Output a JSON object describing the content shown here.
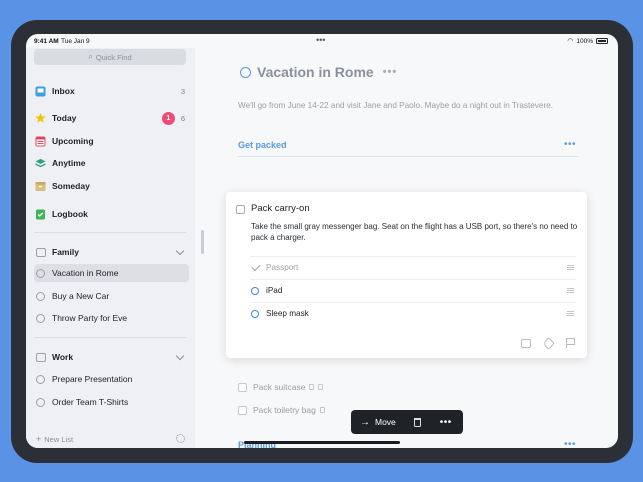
{
  "status": {
    "time": "9:41 AM",
    "date": "Tue Jan 9",
    "battery": "100%"
  },
  "sidebar": {
    "quick_find": "Quick Find",
    "items": [
      {
        "label": "Inbox",
        "count": "3"
      },
      {
        "label": "Today",
        "badge": "1",
        "count": "6"
      },
      {
        "label": "Upcoming"
      },
      {
        "label": "Anytime"
      },
      {
        "label": "Someday"
      },
      {
        "label": "Logbook"
      }
    ],
    "areas": [
      {
        "label": "Family",
        "projects": [
          "Vacation in Rome",
          "Buy a New Car",
          "Throw Party for Eve"
        ]
      },
      {
        "label": "Work",
        "projects": [
          "Prepare Presentation",
          "Order Team T-Shirts"
        ]
      }
    ],
    "new_list": "New List"
  },
  "project": {
    "title": "Vacation in Rome",
    "notes": "We'll go from June 14-22 and visit Jane and Paolo. Maybe do a night out in Trastevere."
  },
  "headings": [
    "Get packed",
    "Planning"
  ],
  "open_todo": {
    "title": "Pack carry-on",
    "notes": "Take the small gray messenger bag. Seat on the flight has a USB port, so there's no need to pack a charger.",
    "checklist": [
      {
        "label": "Passport",
        "done": true
      },
      {
        "label": "iPad",
        "done": false
      },
      {
        "label": "Sleep mask",
        "done": false
      }
    ]
  },
  "todos": [
    "Pack suitcase",
    "Pack toiletry bag"
  ],
  "toolbar": {
    "move": "Move"
  },
  "colors": {
    "accent": "#5a9ae0",
    "badge": "#ee4b76",
    "background": "#5a93e6"
  }
}
